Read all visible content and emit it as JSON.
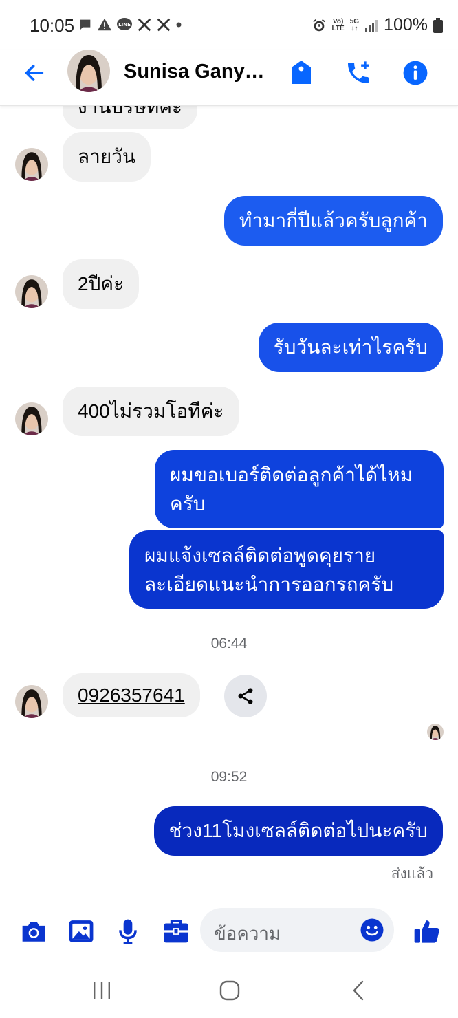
{
  "status_bar": {
    "time": "10:05",
    "battery": "100%",
    "network_top": "Vo)",
    "network_bottom": "LTE",
    "signal_top": "5G"
  },
  "header": {
    "contact_name": "Sunisa Ganya..."
  },
  "messages": [
    {
      "dir": "in",
      "text": "งานบริษัทค่ะ"
    },
    {
      "dir": "in",
      "text": "ลายวัน"
    },
    {
      "dir": "out",
      "text": "ทำมากี่ปีแล้วครับลูกค้า"
    },
    {
      "dir": "in",
      "text": "2ปีค่ะ"
    },
    {
      "dir": "out",
      "text": "รับวันละเท่าไรครับ"
    },
    {
      "dir": "in",
      "text": "400ไม่รวมโอทีค่ะ"
    },
    {
      "dir": "out",
      "line1": "ผมขอเบอร์ติดต่อลูกค้าได้ไหม",
      "line2": "ครับ"
    },
    {
      "dir": "out",
      "line1": "ผมแจ้งเซลล์ติดต่อพูดคุยราย",
      "line2": "ละเอียดแนะนำการออกรถครับ"
    },
    {
      "dir": "in",
      "text": "0926357641"
    },
    {
      "dir": "out",
      "text": "ช่วง11โมงเซลล์ติดต่อไปนะครับ"
    }
  ],
  "timestamps": [
    "06:44",
    "09:52"
  ],
  "sent_status": "ส่งแล้ว",
  "composer": {
    "placeholder": "ข้อความ"
  },
  "colors": {
    "accent": "#0866ff",
    "incoming_bubble": "#f0f0f0",
    "outgoing_top": "#1c5cf0",
    "outgoing_bottom": "#0829bd"
  },
  "icons": [
    "back-arrow-icon",
    "tag-icon",
    "add-call-icon",
    "info-icon",
    "share-icon",
    "camera-icon",
    "gallery-icon",
    "microphone-icon",
    "toolbox-icon",
    "emoji-icon",
    "thumbs-up-icon"
  ]
}
